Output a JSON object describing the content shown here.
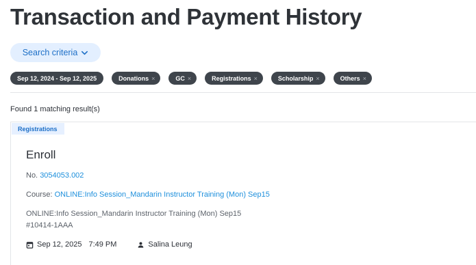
{
  "page": {
    "title": "Transaction and Payment History"
  },
  "search": {
    "label": "Search criteria"
  },
  "filters": {
    "date_range": "Sep 12, 2024 - Sep 12, 2025",
    "chips": [
      "Donations",
      "GC",
      "Registrations",
      "Scholarship",
      "Others"
    ],
    "remove_glyph": "×"
  },
  "results": {
    "summary": "Found 1 matching result(s)"
  },
  "transaction": {
    "category": "Registrations",
    "title": "Enroll",
    "number_label": "No.",
    "number": "3054053.002",
    "course_label": "Course:",
    "course": "ONLINE:Info Session_Mandarin Instructor Training (Mon) Sep15",
    "description": "ONLINE:Info Session_Mandarin Instructor Training (Mon) Sep15",
    "code": "#10414-1AAA",
    "date": "Sep 12, 2025",
    "time": "7:49 PM",
    "person": "Salina Leung"
  },
  "icons": {
    "search_toggle": "chevron-down-icon",
    "date": "calendar-icon",
    "person": "person-icon"
  },
  "colors": {
    "accent": "#1d6fc7",
    "link": "#1d8fdc",
    "chip_bg": "#3f454c",
    "badge_bg": "#e6f0ff"
  }
}
